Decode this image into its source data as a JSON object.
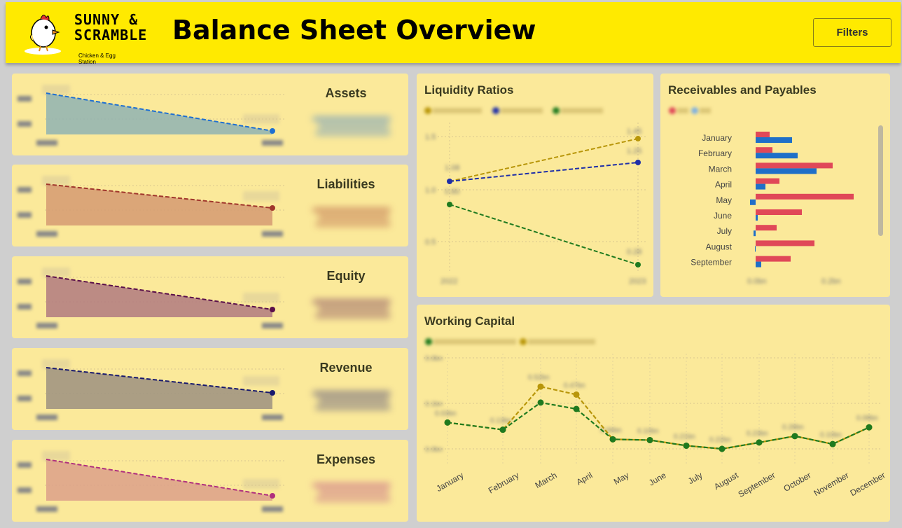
{
  "header": {
    "logo_line1": "SUNNY &",
    "logo_line2": "SCRAMBLE",
    "logo_tagline": "Chicken & Egg Station",
    "title": "Balance Sheet Overview",
    "filters_label": "Filters",
    "brand_color": "#ffea00"
  },
  "kpis": [
    {
      "title": "Assets",
      "color": "#1f6fd1",
      "fill": "#8fb3b3"
    },
    {
      "title": "Liabilities",
      "color": "#a0362c",
      "fill": "#d59a72"
    },
    {
      "title": "Equity",
      "color": "#5a0f4a",
      "fill": "#b07a80"
    },
    {
      "title": "Revenue",
      "color": "#17186e",
      "fill": "#9c9080"
    },
    {
      "title": "Expenses",
      "color": "#b0307e",
      "fill": "#dca08a"
    }
  ],
  "liquidity": {
    "title": "Liquidity Ratios",
    "x_labels": [
      "2022",
      "2023"
    ],
    "y_ticks": [
      "1.5",
      "1.0",
      "0.5"
    ],
    "data_labels": {
      "current": [
        "1.08",
        "1.45"
      ],
      "quick": [
        "",
        "1.25"
      ],
      "cash": [
        "0.80",
        "0.28"
      ]
    }
  },
  "receivables": {
    "title": "Receivables and Payables",
    "months": [
      "January",
      "February",
      "March",
      "April",
      "May",
      "June",
      "July",
      "August",
      "September"
    ],
    "x_ticks": [
      "0.0bn",
      "0.2bn"
    ],
    "colors": {
      "ar": "#e04858",
      "ap": "#1f6fc8"
    }
  },
  "working_capital": {
    "title": "Working Capital",
    "months": [
      "January",
      "February",
      "March",
      "April",
      "May",
      "June",
      "July",
      "August",
      "September",
      "October",
      "November",
      "December"
    ],
    "y_ticks": [
      "0.0bn",
      "0.1bn",
      "0.0bn"
    ],
    "labels_top": [
      "0.03bn",
      "0.13bn",
      "0.52bn",
      "0.47bn",
      "0.06bn",
      "0.10bn",
      "0.21bn",
      "0.22bn",
      "0.23bn",
      "0.28bn",
      "0.10bn",
      "0.08bn"
    ]
  },
  "chart_data": {
    "type": "line",
    "title": "Working Capital",
    "categories": [
      "January",
      "February",
      "March",
      "April",
      "May",
      "June",
      "July",
      "August",
      "September",
      "October",
      "November",
      "December"
    ],
    "series": [
      {
        "values": [
          0.33,
          0.24,
          0.58,
          0.5,
          0.12,
          0.11,
          0.04,
          0.0,
          0.08,
          0.16,
          0.06,
          0.27
        ]
      },
      {
        "values": [
          0.33,
          0.24,
          0.78,
          0.68,
          0.12,
          0.11,
          0.04,
          0.0,
          0.08,
          0.16,
          0.06,
          0.27
        ]
      }
    ],
    "colors": [
      "#1f7a1f",
      "#b8960a"
    ]
  }
}
